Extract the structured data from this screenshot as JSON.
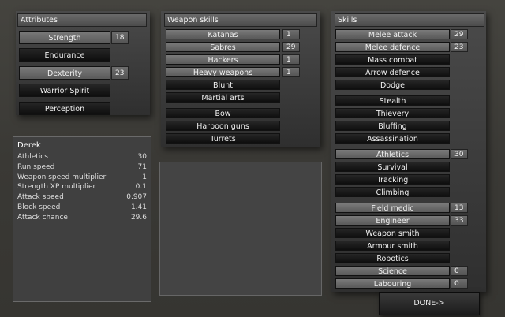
{
  "attributes": {
    "title": "Attributes",
    "items": [
      {
        "label": "Strength",
        "value": "18",
        "style": "light"
      },
      {
        "label": "Endurance",
        "value": "",
        "style": "dark"
      },
      {
        "label": "Dexterity",
        "value": "23",
        "style": "light"
      },
      {
        "label": "Warrior Spirit",
        "value": "",
        "style": "dark"
      },
      {
        "label": "Perception",
        "value": "",
        "style": "dark"
      }
    ]
  },
  "weapon_skills": {
    "title": "Weapon skills",
    "items": [
      {
        "label": "Katanas",
        "value": "1",
        "style": "light"
      },
      {
        "label": "Sabres",
        "value": "29",
        "style": "light"
      },
      {
        "label": "Hackers",
        "value": "1",
        "style": "light"
      },
      {
        "label": "Heavy weapons",
        "value": "1",
        "style": "light"
      },
      {
        "label": "Blunt",
        "value": "",
        "style": "dark"
      },
      {
        "label": "Martial arts",
        "value": "",
        "style": "dark"
      },
      {
        "label": "Bow",
        "value": "",
        "style": "dark"
      },
      {
        "label": "Harpoon guns",
        "value": "",
        "style": "dark"
      },
      {
        "label": "Turrets",
        "value": "",
        "style": "dark"
      }
    ]
  },
  "skills": {
    "title": "Skills",
    "items": [
      {
        "label": "Melee attack",
        "value": "29",
        "style": "light"
      },
      {
        "label": "Melee defence",
        "value": "23",
        "style": "light"
      },
      {
        "label": "Mass combat",
        "value": "",
        "style": "dark"
      },
      {
        "label": "Arrow defence",
        "value": "",
        "style": "dark"
      },
      {
        "label": "Dodge",
        "value": "",
        "style": "dark"
      },
      {
        "label": "Stealth",
        "value": "",
        "style": "dark"
      },
      {
        "label": "Thievery",
        "value": "",
        "style": "dark"
      },
      {
        "label": "Bluffing",
        "value": "",
        "style": "dark"
      },
      {
        "label": "Assassination",
        "value": "",
        "style": "dark"
      },
      {
        "label": "Athletics",
        "value": "30",
        "style": "light"
      },
      {
        "label": "Survival",
        "value": "",
        "style": "dark"
      },
      {
        "label": "Tracking",
        "value": "",
        "style": "dark"
      },
      {
        "label": "Climbing",
        "value": "",
        "style": "dark"
      },
      {
        "label": "Field medic",
        "value": "13",
        "style": "light"
      },
      {
        "label": "Engineer",
        "value": "33",
        "style": "light"
      },
      {
        "label": "Weapon smith",
        "value": "",
        "style": "dark"
      },
      {
        "label": "Armour smith",
        "value": "",
        "style": "dark"
      },
      {
        "label": "Robotics",
        "value": "",
        "style": "dark"
      },
      {
        "label": "Science",
        "value": "0",
        "style": "light"
      },
      {
        "label": "Labouring",
        "value": "0",
        "style": "light"
      }
    ]
  },
  "character": {
    "name": "Derek",
    "stats": [
      {
        "label": "Athletics",
        "value": "30"
      },
      {
        "label": "Run speed",
        "value": "71"
      },
      {
        "label": "Weapon speed multiplier",
        "value": "1"
      },
      {
        "label": "Strength XP multiplier",
        "value": "0.1"
      },
      {
        "label": "Attack speed",
        "value": "0.907"
      },
      {
        "label": "Block speed",
        "value": "1.41"
      },
      {
        "label": "Attack chance",
        "value": "29.6"
      }
    ]
  },
  "done_button": {
    "label": "DONE->"
  }
}
